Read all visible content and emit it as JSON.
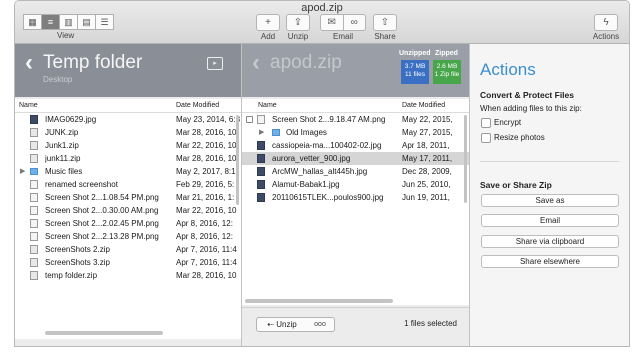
{
  "window": {
    "title": "apod.zip"
  },
  "toolbar": {
    "view_label": "View",
    "view_icons": [
      "icon-grid",
      "list",
      "columns",
      "gallery",
      "outline"
    ],
    "unzip_label": "Unzip",
    "add_label": "Add",
    "email_label": "Email",
    "share_label": "Share",
    "actions_label": "Actions"
  },
  "left_pane": {
    "title": "Temp folder",
    "subtitle": "Desktop",
    "col_name": "Name",
    "col_date": "Date Modified",
    "rows": [
      {
        "name": "IMAG0629.jpg",
        "date": "May 23, 2014, 6:3",
        "type": "img"
      },
      {
        "name": "JUNK.zip",
        "date": "Mar 28, 2016, 10",
        "type": "zip"
      },
      {
        "name": "Junk1.zip",
        "date": "Mar 22, 2016, 10",
        "type": "zip"
      },
      {
        "name": "junk11.zip",
        "date": "Mar 28, 2016, 10",
        "type": "zip"
      },
      {
        "name": "Music files",
        "date": "May 2, 2017, 8:1",
        "type": "folder"
      },
      {
        "name": "renamed screenshot",
        "date": "Feb 29, 2016, 5:",
        "type": "doc"
      },
      {
        "name": "Screen Shot 2...1.08.54 PM.png",
        "date": "Mar 21, 2016, 1:",
        "type": "doc"
      },
      {
        "name": "Screen Shot 2...0.30.00 AM.png",
        "date": "Mar 22, 2016, 10",
        "type": "doc"
      },
      {
        "name": "Screen Shot 2...2.02.45 PM.png",
        "date": "Apr 8, 2016, 12:",
        "type": "doc"
      },
      {
        "name": "Screen Shot 2...2.13.28 PM.png",
        "date": "Apr 8, 2016, 12:",
        "type": "doc"
      },
      {
        "name": "ScreenShots 2.zip",
        "date": "Apr 7, 2016, 11:4",
        "type": "zip"
      },
      {
        "name": "ScreenShots 3.zip",
        "date": "Apr 7, 2016, 11:4",
        "type": "zip"
      },
      {
        "name": "temp folder.zip",
        "date": "Mar 28, 2016, 10",
        "type": "zip"
      }
    ]
  },
  "mid_pane": {
    "title": "apod.zip",
    "unzipped_label": "Unzipped",
    "zipped_label": "Zipped",
    "unzipped_size": "3.7 MB",
    "unzipped_count": "11 files",
    "zipped_size": "2.6 MB",
    "zipped_count": "1 Zip file",
    "unzipped_color": "#3a6fc4",
    "zipped_color": "#48a64a",
    "col_name": "Name",
    "col_date": "Date Modified",
    "rows": [
      {
        "name": "Screen Shot 2...9.18.47 AM.png",
        "date": "May 22, 2015,",
        "type": "doc",
        "lock": true
      },
      {
        "name": "Old Images",
        "date": "May 27, 2015,",
        "type": "folder",
        "disclosure": true
      },
      {
        "name": "cassiopeia-ma...100402-02.jpg",
        "date": "Apr 18, 2011,",
        "type": "img"
      },
      {
        "name": "aurora_vetter_900.jpg",
        "date": "May 17, 2011,",
        "type": "img",
        "selected": true
      },
      {
        "name": "ArcMW_hallas_alt445h.jpg",
        "date": "Dec 28, 2009,",
        "type": "img"
      },
      {
        "name": "Alamut-Babak1.jpg",
        "date": "Jun 25, 2010,",
        "type": "img"
      },
      {
        "name": "20110615TLEK...poulos900.jpg",
        "date": "Jun 19, 2011,",
        "type": "img"
      }
    ],
    "unzip_button": "Unzip",
    "more_button": "ooo",
    "selection_status": "1 files selected"
  },
  "actions_panel": {
    "title": "Actions",
    "convert_heading": "Convert & Protect Files",
    "convert_sub": "When adding files to this zip:",
    "encrypt_label": "Encrypt",
    "resize_label": "Resize photos",
    "save_heading": "Save or Share Zip",
    "save_as": "Save as",
    "email": "Email",
    "share_clipboard": "Share via clipboard",
    "share_elsewhere": "Share elsewhere"
  }
}
